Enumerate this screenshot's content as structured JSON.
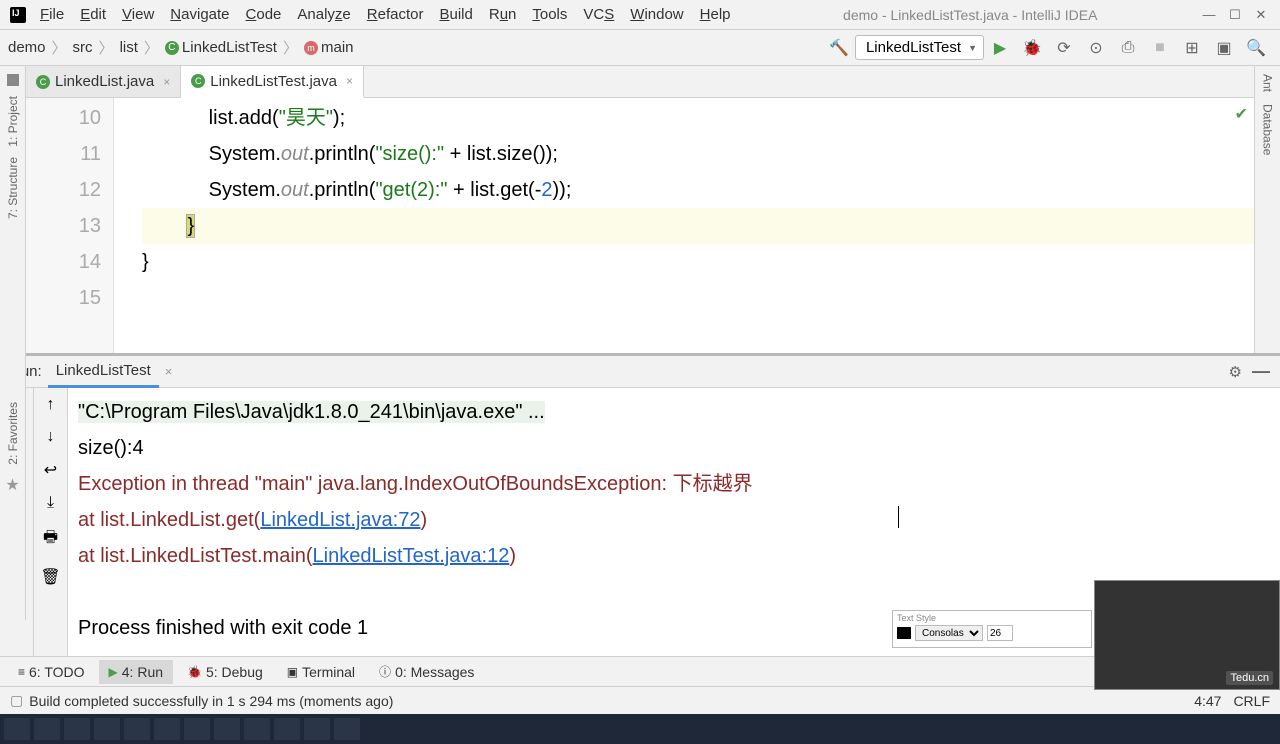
{
  "window": {
    "title": "demo - LinkedListTest.java - IntelliJ IDEA"
  },
  "menu": {
    "file": "File",
    "edit": "Edit",
    "view": "View",
    "navigate": "Navigate",
    "code": "Code",
    "analyze": "Analyze",
    "refactor": "Refactor",
    "build": "Build",
    "run": "Run",
    "tools": "Tools",
    "vcs": "VCS",
    "window": "Window",
    "help": "Help"
  },
  "breadcrumb": {
    "project": "demo",
    "src": "src",
    "pkg": "list",
    "class": "LinkedListTest",
    "method": "main"
  },
  "run_config": "LinkedListTest",
  "tabs": {
    "t1": "LinkedList.java",
    "t2": "LinkedListTest.java"
  },
  "code_lines": {
    "l10": {
      "num": "10",
      "p1": "            list.add(",
      "s": "\"昊天\"",
      "p2": ");"
    },
    "l11": {
      "num": "11",
      "p1": "            System.",
      "kw": "out",
      "p2": ".println(",
      "s": "\"size():\"",
      "p3": " + list.size());"
    },
    "l12": {
      "num": "12",
      "p1": "            System.",
      "kw": "out",
      "p2": ".println(",
      "s": "\"get(2):\"",
      "p3": " + list.get(-",
      "n": "2",
      "p4": "));"
    },
    "l13": {
      "num": "13",
      "text": "        }"
    },
    "l14": {
      "num": "14",
      "text": "}"
    },
    "l15": {
      "num": "15",
      "text": ""
    }
  },
  "run_panel": {
    "label": "Run:",
    "config": "LinkedListTest"
  },
  "console": {
    "cmd": "\"C:\\Program Files\\Java\\jdk1.8.0_241\\bin\\java.exe\" ...",
    "out1": "size():4",
    "err1_a": "Exception in thread \"main\" ",
    "err1_b": "java.lang.IndexOutOfBoundsException",
    "err1_c": ": 下标越界",
    "err2_a": "    at list.LinkedList.get(",
    "err2_link": "LinkedList.java:72",
    "err2_b": ")",
    "err3_a": "    at list.LinkedListTest.main(",
    "err3_link": "LinkedListTest.java:12",
    "err3_b": ")",
    "exit": "Process finished with exit code 1"
  },
  "bottom_tabs": {
    "todo": "6: TODO",
    "run": "4: Run",
    "debug": "5: Debug",
    "terminal": "Terminal",
    "messages": "0: Messages"
  },
  "status": {
    "msg": "Build completed successfully in 1 s 294 ms (moments ago)",
    "pos": "4:47",
    "le": "CRLF"
  },
  "side_labels": {
    "project": "1: Project",
    "structure": "7: Structure",
    "favorites": "2: Favorites",
    "ant": "Ant",
    "database": "Database"
  },
  "text_style": {
    "title": "Text Style",
    "font": "Consolas",
    "size": "26"
  },
  "watermark": "Tedu.cn"
}
